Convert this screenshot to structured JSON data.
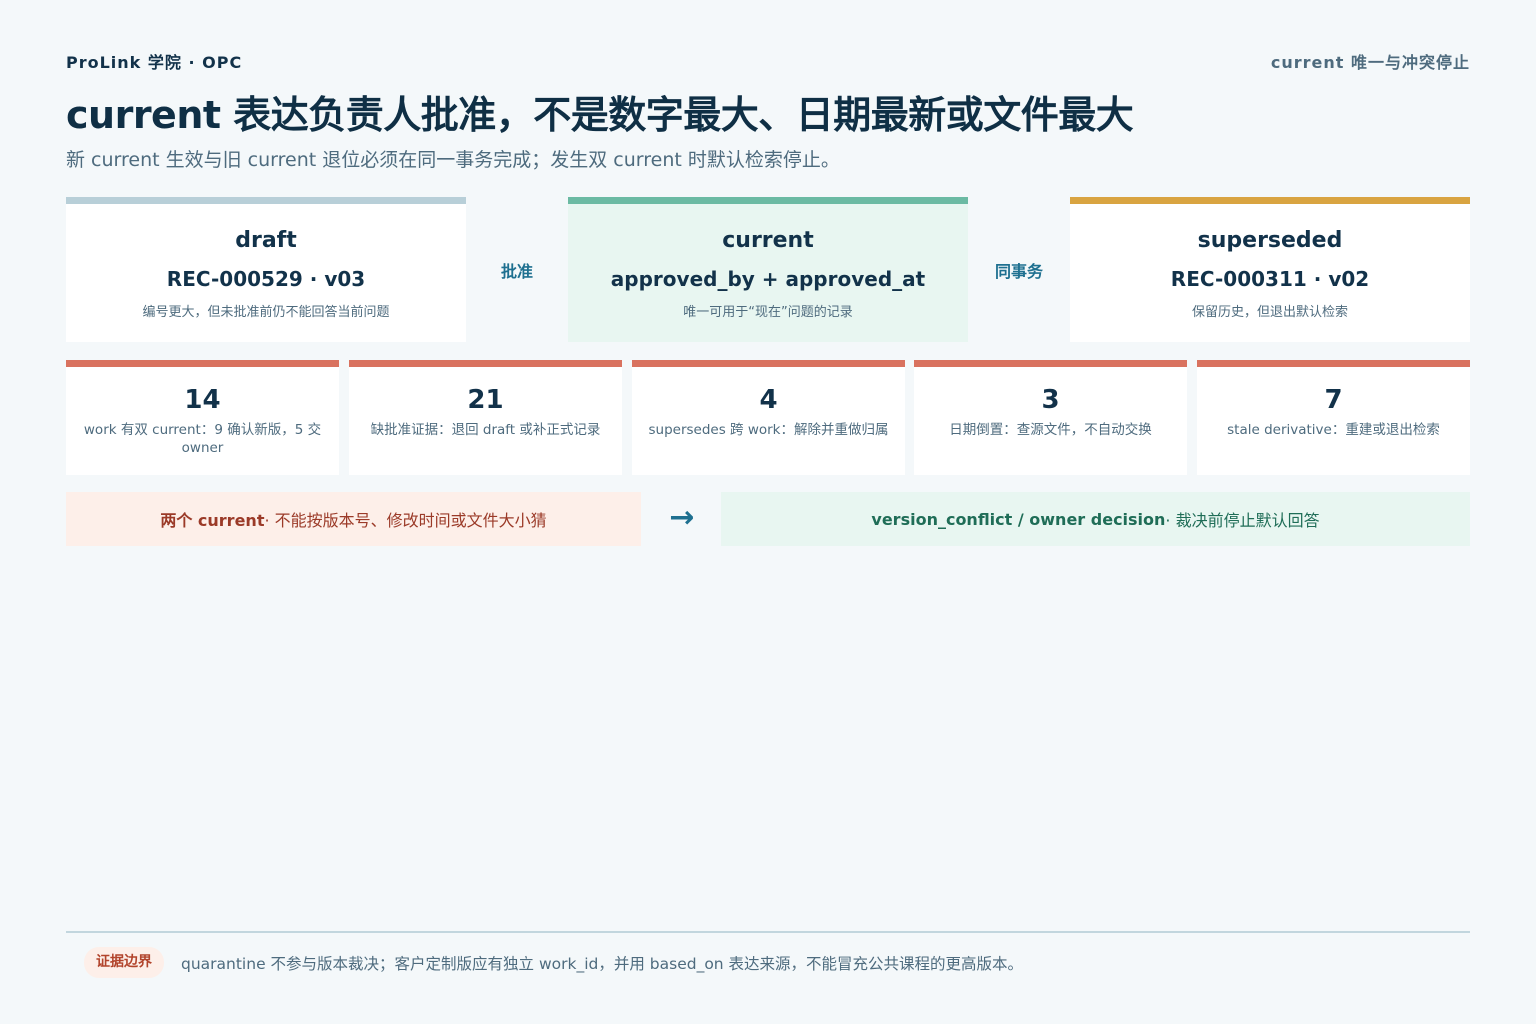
{
  "header": {
    "brand": "ProLink 学院 · OPC",
    "tagline": "current 唯一与冲突停止",
    "title": "current 表达负责人批准，不是数字最大、日期最新或文件最大",
    "subtitle": "新 current 生效与旧 current 退位必须在同一事务完成；发生双 current 时默认检索停止。"
  },
  "states": [
    {
      "name": "draft",
      "record": "REC-000529 · v03",
      "note": "编号更大，但未批准前仍不能回答当前问题",
      "bar_color": "#b8cfd8"
    },
    {
      "name": "current",
      "record": "approved_by + approved_at",
      "note": "唯一可用于“现在”问题的记录",
      "bar_color": "#6bbaa3"
    },
    {
      "name": "superseded",
      "record": "REC-000311 · v02",
      "note": "保留历史，但退出默认检索",
      "bar_color": "#d9a441"
    }
  ],
  "connectors": [
    "批准",
    "同事务"
  ],
  "stats": [
    {
      "value": "14",
      "label": "work 有双 current：9 确认新版，5 交 owner"
    },
    {
      "value": "21",
      "label": "缺批准证据：退回 draft 或补正式记录"
    },
    {
      "value": "4",
      "label": "supersedes 跨 work：解除并重做归属"
    },
    {
      "value": "3",
      "label": "日期倒置：查源文件，不自动交换"
    },
    {
      "value": "7",
      "label": "stale derivative：重建或退出检索"
    }
  ],
  "flow": {
    "conflict_strong": "两个 current",
    "conflict_rest": " · 不能按版本号、修改时间或文件大小猜",
    "arrow": "→",
    "decision_strong": "version_conflict / owner decision",
    "decision_rest": " · 裁决前停止默认回答"
  },
  "footer": {
    "badge": "证据边界",
    "note": "quarantine 不参与版本裁决；客户定制版应有独立 work_id，并用 based_on 表达来源，不能冒充公共课程的更高版本。"
  }
}
